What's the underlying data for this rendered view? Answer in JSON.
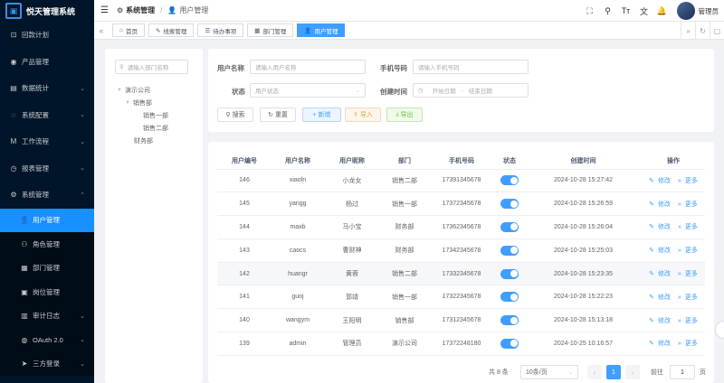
{
  "app": {
    "title": "悦天管理系统",
    "logo_glyph": "▣"
  },
  "sidebar": {
    "items": [
      {
        "label": "回款计划",
        "icon": "calendar-icon",
        "glyph": "⊡",
        "chevron": false
      },
      {
        "label": "产品管理",
        "icon": "product-icon",
        "glyph": "◉",
        "chevron": false
      },
      {
        "label": "数据统计",
        "icon": "chart-icon",
        "glyph": "▤",
        "chevron": true
      },
      {
        "label": "系统配置",
        "icon": "config-icon",
        "glyph": "◌",
        "chevron": true
      },
      {
        "label": "工作流程",
        "icon": "workflow-icon",
        "glyph": "M",
        "chevron": true
      },
      {
        "label": "报表管理",
        "icon": "report-icon",
        "glyph": "◷",
        "chevron": true
      },
      {
        "label": "系统管理",
        "icon": "gear-icon",
        "glyph": "⚙",
        "chevron": true
      }
    ],
    "subitems": [
      {
        "label": "用户管理",
        "icon": "user-icon",
        "glyph": "👤",
        "active": true
      },
      {
        "label": "角色管理",
        "icon": "role-icon",
        "glyph": "⚇",
        "active": false
      },
      {
        "label": "部门管理",
        "icon": "dept-icon",
        "glyph": "▦",
        "active": false
      },
      {
        "label": "岗位管理",
        "icon": "post-icon",
        "glyph": "▣",
        "active": false
      },
      {
        "label": "审计日志",
        "icon": "log-icon",
        "glyph": "▥",
        "active": false,
        "chevron": true
      },
      {
        "label": "OAuth 2.0",
        "icon": "oauth-icon",
        "glyph": "◍",
        "active": false,
        "chevron": true
      },
      {
        "label": "三方登录",
        "icon": "login-icon",
        "glyph": "➤",
        "active": false,
        "chevron": true
      }
    ]
  },
  "header": {
    "breadcrumb": [
      "系统管理",
      "用户管理"
    ],
    "username": "管理员"
  },
  "tags": [
    {
      "label": "首页",
      "glyph": "⌂",
      "active": false
    },
    {
      "label": "线索管理",
      "glyph": "✎",
      "active": false
    },
    {
      "label": "待办事项",
      "glyph": "☰",
      "active": false
    },
    {
      "label": "部门管理",
      "glyph": "▦",
      "active": false
    },
    {
      "label": "用户管理",
      "glyph": "👤",
      "active": true
    }
  ],
  "tree": {
    "search_placeholder": "请输入部门名称",
    "nodes": [
      "演示公司",
      "销售部",
      "销售一部",
      "销售二部",
      "财务部"
    ]
  },
  "form": {
    "username_label": "用户名称",
    "username_placeholder": "请输入用户名称",
    "mobile_label": "手机号码",
    "mobile_placeholder": "请输入手机号码",
    "status_label": "状态",
    "status_placeholder": "用户状态",
    "time_label": "创建时间",
    "start_placeholder": "开始日期",
    "range_sep": "-",
    "end_placeholder": "结束日期",
    "buttons": {
      "search": "搜索",
      "reset": "重置",
      "add": "新增",
      "import": "导入",
      "export": "导出"
    }
  },
  "table": {
    "columns": [
      "用户编号",
      "用户名称",
      "用户昵称",
      "部门",
      "手机号码",
      "状态",
      "创建时间",
      "操作"
    ],
    "rows": [
      {
        "id": "146",
        "name": "xiaoln",
        "nick": "小龙女",
        "dept": "销售二部",
        "mobile": "17391345678",
        "status": true,
        "time": "2024-10-28 15:27:42"
      },
      {
        "id": "145",
        "name": "yangg",
        "nick": "杨过",
        "dept": "销售一部",
        "mobile": "17372345678",
        "status": true,
        "time": "2024-10-28 15:26:59"
      },
      {
        "id": "144",
        "name": "maxb",
        "nick": "马小宝",
        "dept": "财务部",
        "mobile": "17362345678",
        "status": true,
        "time": "2024-10-28 15:26:04"
      },
      {
        "id": "143",
        "name": "caocs",
        "nick": "曹财神",
        "dept": "财务部",
        "mobile": "17342345678",
        "status": true,
        "time": "2024-10-28 15:25:03"
      },
      {
        "id": "142",
        "name": "huangr",
        "nick": "黄蓉",
        "dept": "销售二部",
        "mobile": "17332345678",
        "status": true,
        "time": "2024-10-28 15:23:35"
      },
      {
        "id": "141",
        "name": "guoj",
        "nick": "郭靖",
        "dept": "销售一部",
        "mobile": "17322345678",
        "status": true,
        "time": "2024-10-28 15:22:23"
      },
      {
        "id": "140",
        "name": "wangym",
        "nick": "王阳明",
        "dept": "销售部",
        "mobile": "17312345678",
        "status": true,
        "time": "2024-10-28 15:13:18"
      },
      {
        "id": "139",
        "name": "admin",
        "nick": "管理员",
        "dept": "演示公司",
        "mobile": "17372248180",
        "status": true,
        "time": "2024-10-25 10:16:57"
      }
    ],
    "op_edit": "修改",
    "op_more": "更多"
  },
  "pager": {
    "total": "共 8 条",
    "size": "10条/页",
    "current": "1",
    "goto_label": "前往",
    "goto_value": "1",
    "unit": "页"
  },
  "colors": {
    "accent": "#409eff",
    "sidebar_bg": "#001529",
    "active_menu": "#1890ff"
  }
}
